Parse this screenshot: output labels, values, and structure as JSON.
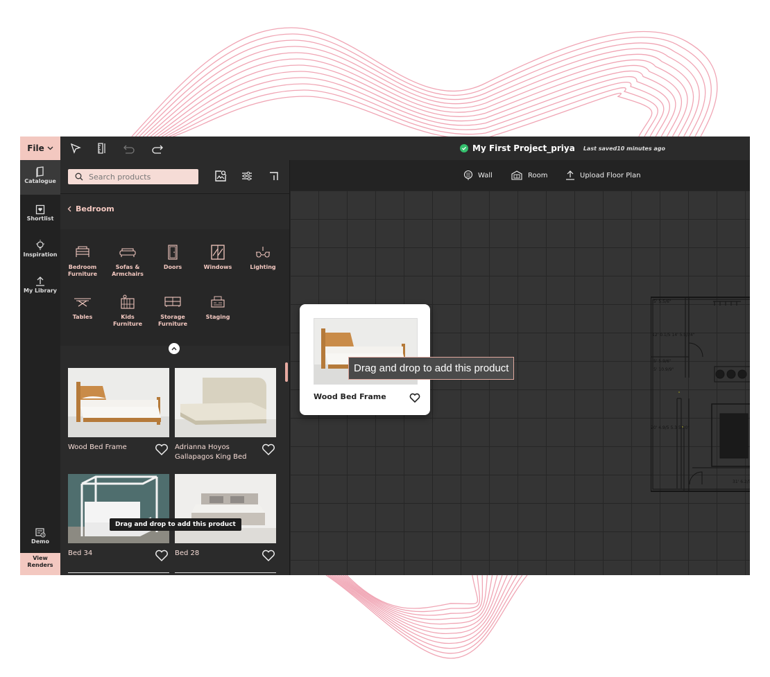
{
  "topbar": {
    "file_label": "File",
    "project_title": "My First Project_priya",
    "last_saved": "Last saved10 minutes ago"
  },
  "rail": {
    "items": [
      {
        "label": "Catalogue",
        "icon": "catalogue-icon"
      },
      {
        "label": "Shortlist",
        "icon": "shortlist-icon"
      },
      {
        "label": "Inspiration",
        "icon": "bulb-icon"
      },
      {
        "label": "My Library",
        "icon": "upload-icon"
      }
    ],
    "demo_label": "Demo",
    "renders_label": "View Renders"
  },
  "panel": {
    "search_placeholder": "Search products",
    "breadcrumb": "Bedroom",
    "categories": [
      {
        "label": "Bedroom Furniture"
      },
      {
        "label": "Sofas & Armchairs"
      },
      {
        "label": "Doors"
      },
      {
        "label": "Windows"
      },
      {
        "label": "Lighting"
      },
      {
        "label": "Tables"
      },
      {
        "label": "Kids Furniture"
      },
      {
        "label": "Storage Furniture"
      },
      {
        "label": "Staging"
      }
    ],
    "products": [
      {
        "name": "Wood Bed Frame"
      },
      {
        "name": "Adrianna Hoyos Gallapagos King Bed"
      },
      {
        "name": "Bed 34"
      },
      {
        "name": "Bed 28"
      }
    ],
    "tooltip": "Drag and drop to add this product"
  },
  "canvasbar": {
    "wall_label": "Wall",
    "room_label": "Room",
    "upload_label": "Upload Floor Plan"
  },
  "drag": {
    "product_name": "Wood Bed Frame",
    "tooltip": "Drag and drop to add this product"
  },
  "colors": {
    "accent": "#f3c8c0",
    "panel_bg": "#2b2b2b",
    "canvas_bg": "#343434",
    "saved_ok": "#35c06e"
  }
}
